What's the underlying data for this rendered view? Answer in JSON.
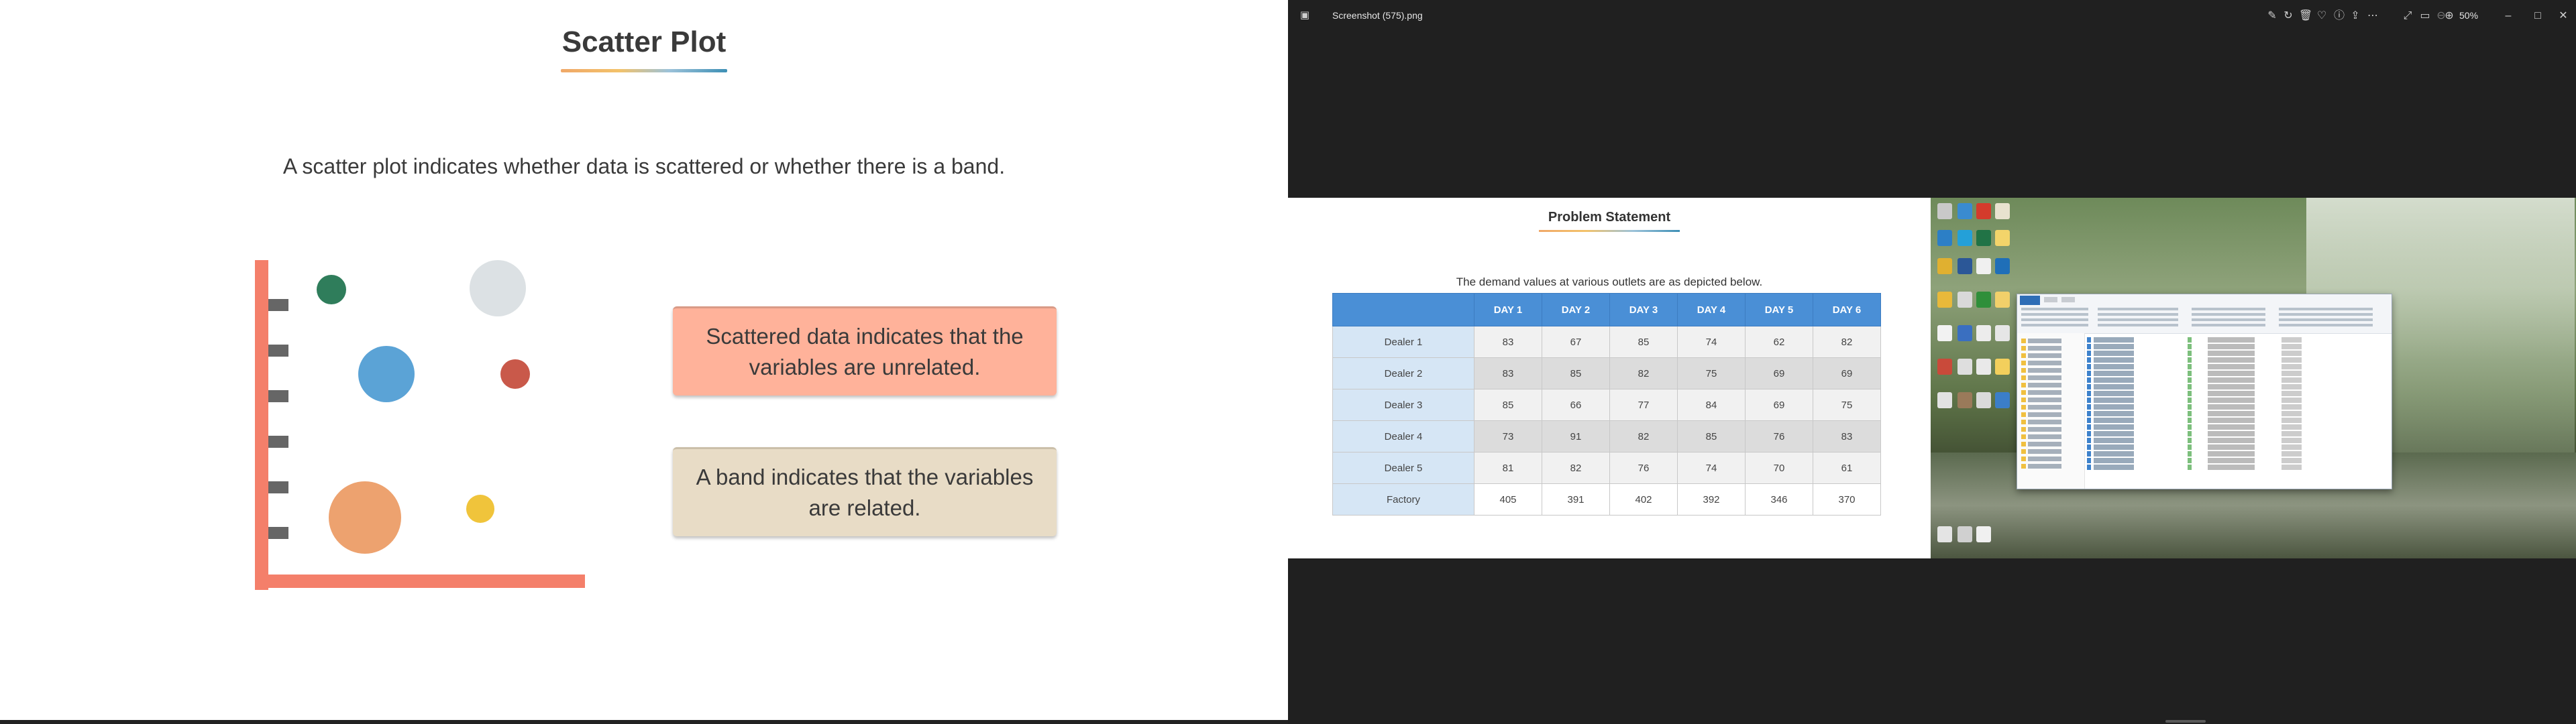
{
  "slide": {
    "title": "Scatter Plot",
    "description": "A scatter plot indicates whether data is scattered or whether there is a band.",
    "boxes": {
      "scattered": "Scattered data indicates that the variables are unrelated.",
      "band": "A band indicates that the variables are related."
    },
    "colors": {
      "axis": "#f47f6a",
      "tick": "#666666",
      "scattered_box": "#ffb29a",
      "band_box": "#e8dcc6"
    },
    "bubbles": [
      {
        "color": "#2f7d5b"
      },
      {
        "color": "#dce1e4"
      },
      {
        "color": "#5ba3d6"
      },
      {
        "color": "#c9594a"
      },
      {
        "color": "#eda26f"
      },
      {
        "color": "#f0c43b"
      }
    ]
  },
  "viewer": {
    "filename": "Screenshot (575).png",
    "zoom": "50%",
    "icons": [
      "photo-app-icon",
      "edit-image-icon",
      "rotate-icon",
      "delete-icon",
      "favorite-icon",
      "info-icon",
      "share-icon",
      "more-icon",
      "fullscreen-icon",
      "slideshow-icon",
      "zoom-out-icon",
      "zoom-in-icon",
      "minimize-icon",
      "maximize-icon",
      "close-icon"
    ]
  },
  "embedded_slide": {
    "title": "Problem Statement",
    "caption": "The demand values at various outlets are as depicted below.",
    "columns": [
      "DAY 1",
      "DAY 2",
      "DAY 3",
      "DAY 4",
      "DAY 5",
      "DAY 6"
    ],
    "rows": [
      {
        "label": "Dealer 1",
        "values": [
          "83",
          "67",
          "85",
          "74",
          "62",
          "82"
        ]
      },
      {
        "label": "Dealer 2",
        "values": [
          "83",
          "85",
          "82",
          "75",
          "69",
          "69"
        ]
      },
      {
        "label": "Dealer 3",
        "values": [
          "85",
          "66",
          "77",
          "84",
          "69",
          "75"
        ]
      },
      {
        "label": "Dealer 4",
        "values": [
          "73",
          "91",
          "82",
          "85",
          "76",
          "83"
        ]
      },
      {
        "label": "Dealer 5",
        "values": [
          "81",
          "82",
          "76",
          "74",
          "70",
          "61"
        ]
      },
      {
        "label": "Factory",
        "values": [
          "405",
          "391",
          "402",
          "392",
          "346",
          "370"
        ]
      }
    ]
  }
}
